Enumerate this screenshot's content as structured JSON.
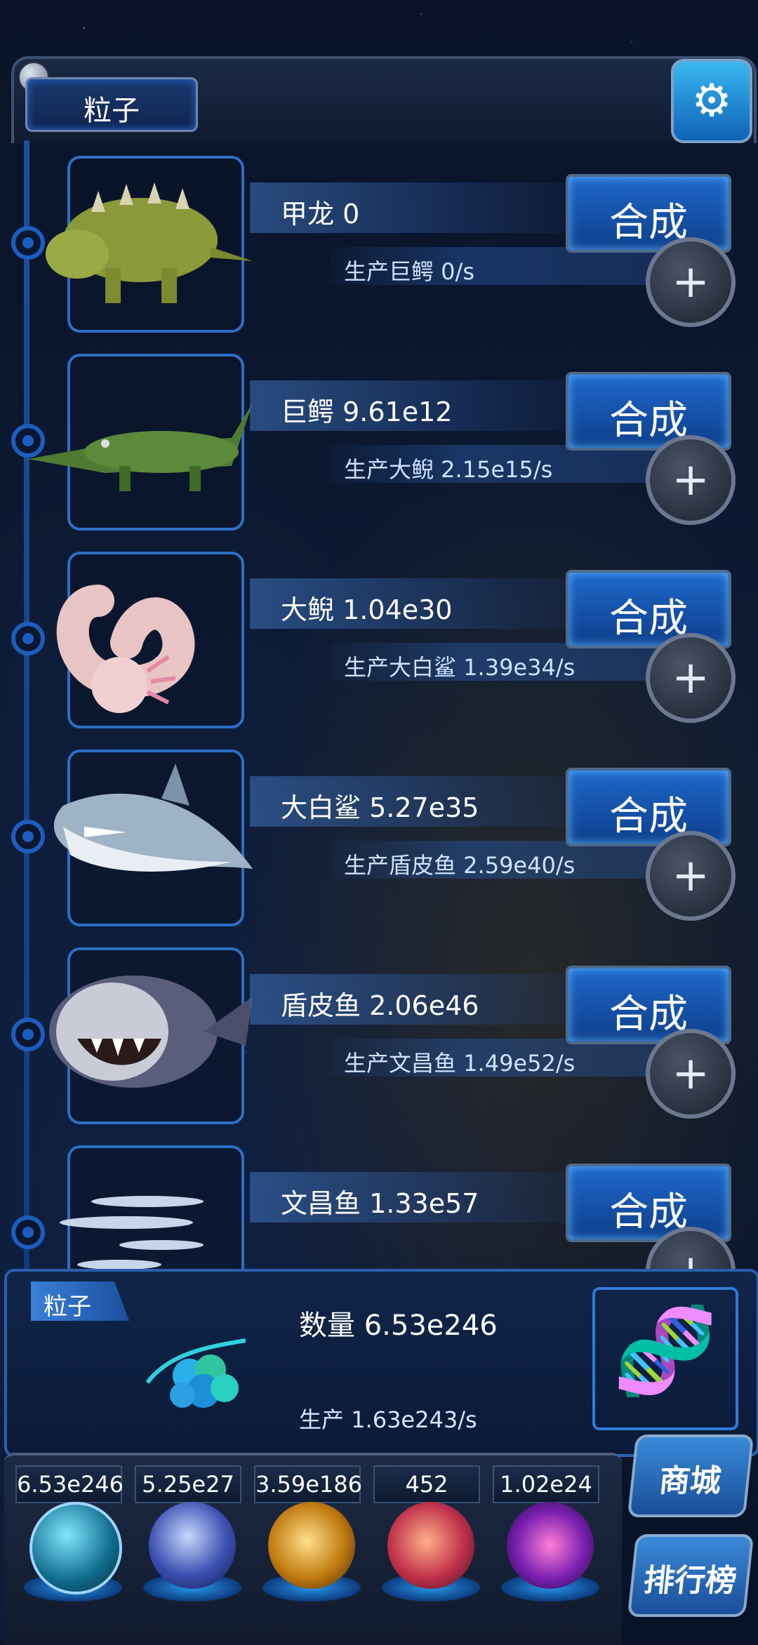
{
  "header": {
    "title": "粒子"
  },
  "rows": [
    {
      "name": "甲龙 0",
      "production": "生产巨鳄 0/s",
      "merge_label": "合成",
      "creature": "ankylosaurus"
    },
    {
      "name": "巨鳄 9.61e12",
      "production": "生产大鲵 2.15e15/s",
      "merge_label": "合成",
      "creature": "crocodile"
    },
    {
      "name": "大鲵 1.04e30",
      "production": "生产大白鲨 1.39e34/s",
      "merge_label": "合成",
      "creature": "axolotl"
    },
    {
      "name": "大白鲨 5.27e35",
      "production": "生产盾皮鱼 2.59e40/s",
      "merge_label": "合成",
      "creature": "great-white-shark"
    },
    {
      "name": "盾皮鱼 2.06e46",
      "production": "生产文昌鱼 1.49e52/s",
      "merge_label": "合成",
      "creature": "dunkleosteus"
    },
    {
      "name": "文昌鱼 1.33e57",
      "production": "",
      "merge_label": "合成",
      "creature": "lancelet"
    }
  ],
  "info_panel": {
    "tag": "粒子",
    "count": "数量 6.53e246",
    "rate": "生产 1.63e243/s"
  },
  "resources": [
    {
      "value": "6.53e246",
      "orb": "particle-orb"
    },
    {
      "value": "5.25e27",
      "orb": "lightning-orb"
    },
    {
      "value": "3.59e186",
      "orb": "galaxy-orb"
    },
    {
      "value": "452",
      "orb": "brain-orb"
    },
    {
      "value": "1.02e24",
      "orb": "vortex-orb"
    }
  ],
  "side_buttons": {
    "shop": "商城",
    "ranking": "排行榜"
  },
  "colors": {
    "accent": "#1e67c9",
    "frame": "#2c6fc4",
    "background": "#0c1a33"
  }
}
